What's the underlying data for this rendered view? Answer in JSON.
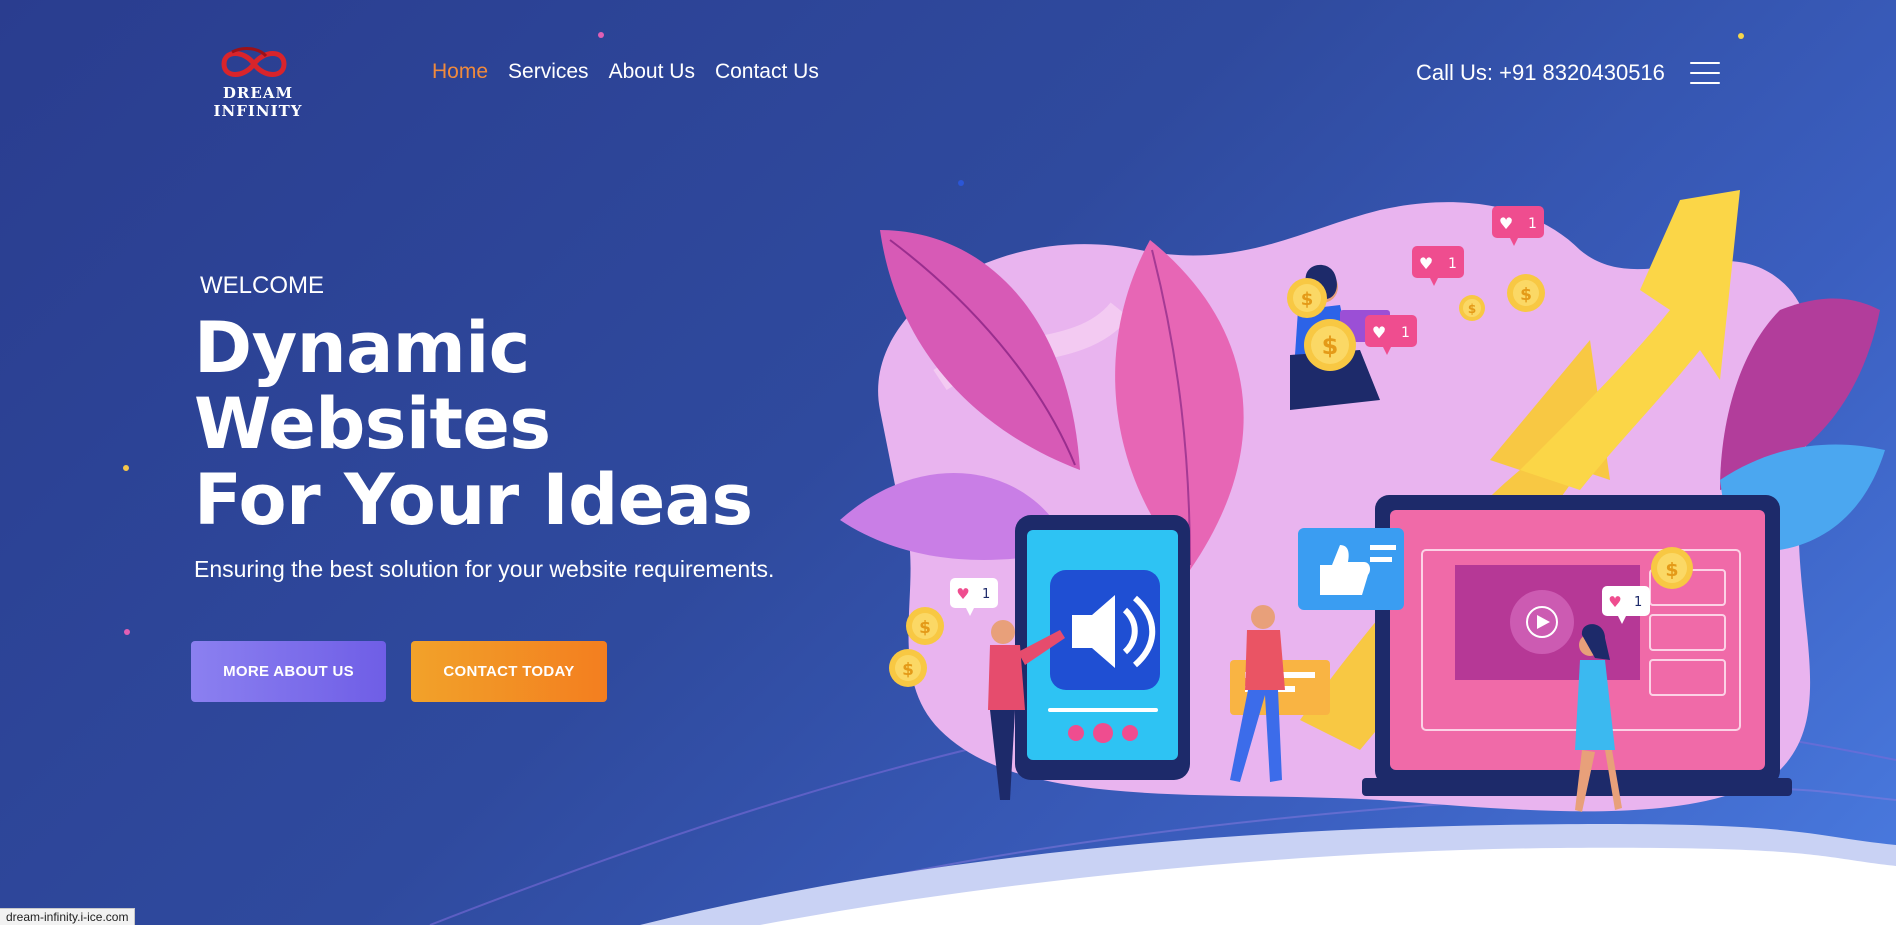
{
  "brand": {
    "name": "DREAM INFINITY"
  },
  "nav": {
    "items": [
      {
        "label": "Home",
        "active": true
      },
      {
        "label": "Services",
        "active": false
      },
      {
        "label": "About Us",
        "active": false
      },
      {
        "label": "Contact Us",
        "active": false
      }
    ]
  },
  "header": {
    "call": "Call Us: +91 8320430516",
    "menu_icon": "hamburger-icon"
  },
  "hero": {
    "welcome": "WELCOME",
    "headline": [
      "Dynamic",
      "Websites",
      "For Your Ideas"
    ],
    "subtext": "Ensuring the best solution for your website requirements.",
    "buttons": [
      {
        "label": "MORE ABOUT US"
      },
      {
        "label": "CONTACT TODAY"
      }
    ],
    "likes": [
      "1",
      "1",
      "1",
      "1",
      "1"
    ]
  },
  "status_bar": {
    "url": "dream-infinity.i-ice.com"
  },
  "colors": {
    "background": "#2f4a9e",
    "accent_nav": "#f08a3c",
    "button_about": "#7b6ee8",
    "button_contact": "#f38e24"
  }
}
